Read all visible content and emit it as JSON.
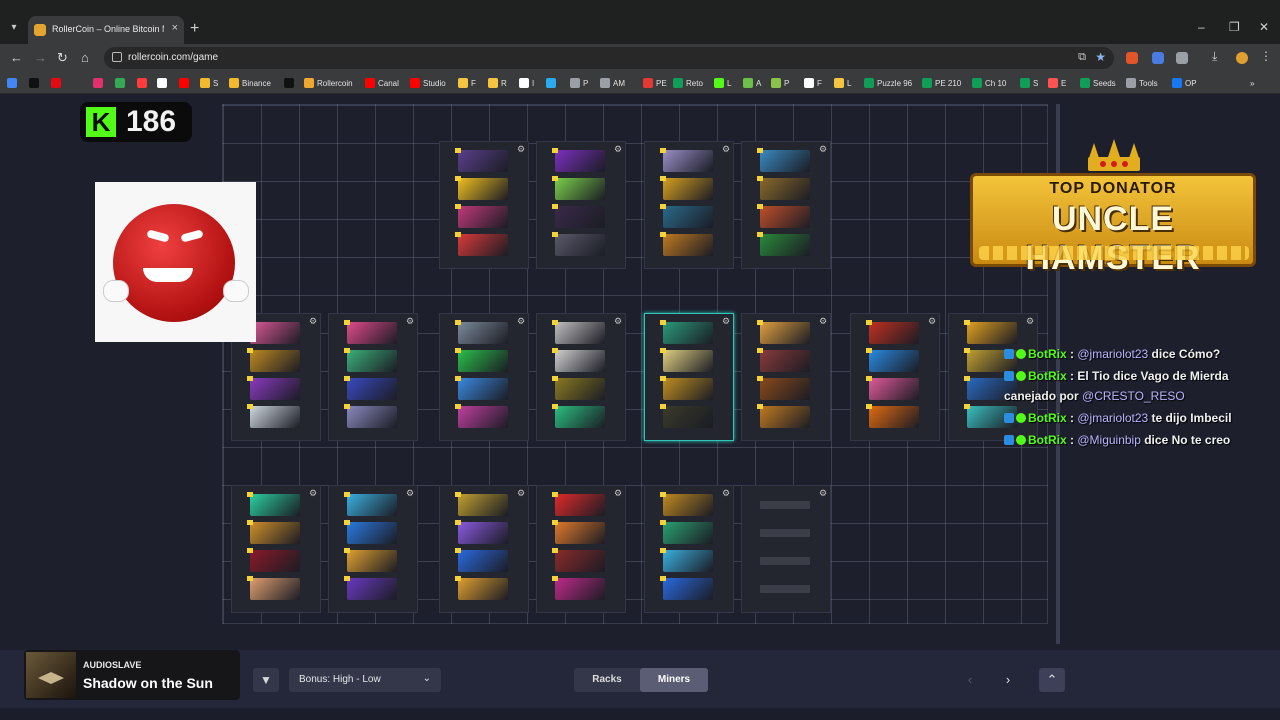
{
  "browser": {
    "tab_title": "RollerCoin – Online Bitcoin Mi",
    "tab_close": "×",
    "new_tab": "+",
    "url": "rollercoin.com/game",
    "bookmarks": [
      "",
      "",
      "",
      "",
      "",
      "",
      "",
      "",
      "S",
      "Binance",
      "",
      "Rollercoin",
      "Canal",
      "Studio",
      "F",
      "R",
      "I",
      "",
      "P",
      "AM",
      "PE",
      "Reto",
      "L",
      "A",
      "P",
      "F",
      "L",
      "Puzzle 96",
      "PE 210",
      "Ch 10",
      "S",
      "E",
      "Seeds",
      "Tools",
      "OP"
    ],
    "bookmark_colors": [
      "#4285f4",
      "#111111",
      "#e50914",
      "#e1306c",
      "#34a853",
      "#ff3b3b",
      "#ffffff",
      "#ff0000",
      "#f3ba2f",
      "#f3ba2f",
      "#111111",
      "#f0a830",
      "#ff0000",
      "#ff0000",
      "#f5c542",
      "#f5c542",
      "#ffffff",
      "#2aabee",
      "#9aa0a6",
      "#9aa0a6",
      "#e53935",
      "#0f9d58",
      "#53fc18",
      "#6cc04a",
      "#8bc34a",
      "#ffffff",
      "#f5c542",
      "#0f9d58",
      "#0f9d58",
      "#0f9d58",
      "#0f9d58",
      "#ff5252",
      "#0f9d58",
      "#9aa0a6",
      "#1877f2"
    ]
  },
  "kick": {
    "viewers": "186"
  },
  "donator": {
    "heading": "TOP DONATOR",
    "name": "UNCLE HAMSTER"
  },
  "chat": [
    {
      "user": "BotRix",
      "sep": " : ",
      "mention": "@jmariolot23",
      "text": " dice Cómo?"
    },
    {
      "user": "BotRix",
      "sep": " : ",
      "mention": "",
      "text": "El Tio dice Vago de Mierda canejado por ",
      "mention2": "@CRESTO_RESO"
    },
    {
      "user": "BotRix",
      "sep": " : ",
      "mention": "@jmariolot23",
      "text": " te dijo Imbecil"
    },
    {
      "user": "BotRix",
      "sep": " : ",
      "mention": "@Miguinbip",
      "text": " dice No te creo"
    }
  ],
  "racks": {
    "rows": [
      [
        [
          "#5a3f8c",
          "#f0c020",
          "#c03a7a",
          "#d93a3a"
        ],
        [
          "#7b2fbf",
          "#7bd04a",
          "#3a2a4a",
          "#5a5a6a"
        ],
        [
          "#9a8fc8",
          "#d6a020",
          "#2a6a8a",
          "#c07a20"
        ],
        [
          "#3a8ac0",
          "#8a6a2a",
          "#c0502a",
          "#2a8a3a"
        ]
      ],
      [
        [
          "#e05a9a",
          "#c08a20",
          "#8a3ac0",
          "#cfd8e0"
        ],
        [
          "#e04a8a",
          "#3ab07a",
          "#3a4ac0",
          "#8a8ac0"
        ],
        [
          "#7a8a9a",
          "#2ac04a",
          "#3a8ae0",
          "#c040a0"
        ],
        [
          "#c0c0c0",
          "#d0d0d0",
          "#8a7a20",
          "#2ac080"
        ],
        [
          "#2a9a7a",
          "#e0d080",
          "#c09020",
          "#3a3a2a"
        ],
        [
          "#e0a040",
          "#8a3a3a",
          "#8a4a1a",
          "#c07a20"
        ],
        [
          "#c03020",
          "#2a8ae0",
          "#e05a9a",
          "#e06a10"
        ],
        [
          "#e0a020",
          "#c0a030",
          "#2a6ac0",
          "#3ac0c0"
        ]
      ],
      [
        [
          "#2ad0a0",
          "#d0902a",
          "#8a1a2a",
          "#e0a070"
        ],
        [
          "#3ab0e0",
          "#2a7ae0",
          "#e0a030",
          "#6a3ac0"
        ],
        [
          "#c0a030",
          "#8a5ae0",
          "#2a6ae0",
          "#e0a030"
        ],
        [
          "#e02a2a",
          "#e07a2a",
          "#8a2a2a",
          "#c02a8a"
        ],
        [
          "#c08a20",
          "#2aa070",
          "#3ab0e0",
          "#2a6ae0"
        ],
        [
          "empty",
          "empty",
          "empty",
          "empty"
        ]
      ]
    ]
  },
  "music": {
    "artist": "AUDIOSLAVE",
    "title": "Shadow on the Sun"
  },
  "controls": {
    "sort_label": "Bonus: High - Low",
    "tab_racks": "Racks",
    "tab_miners": "Miners",
    "active_tab": "Miners"
  }
}
